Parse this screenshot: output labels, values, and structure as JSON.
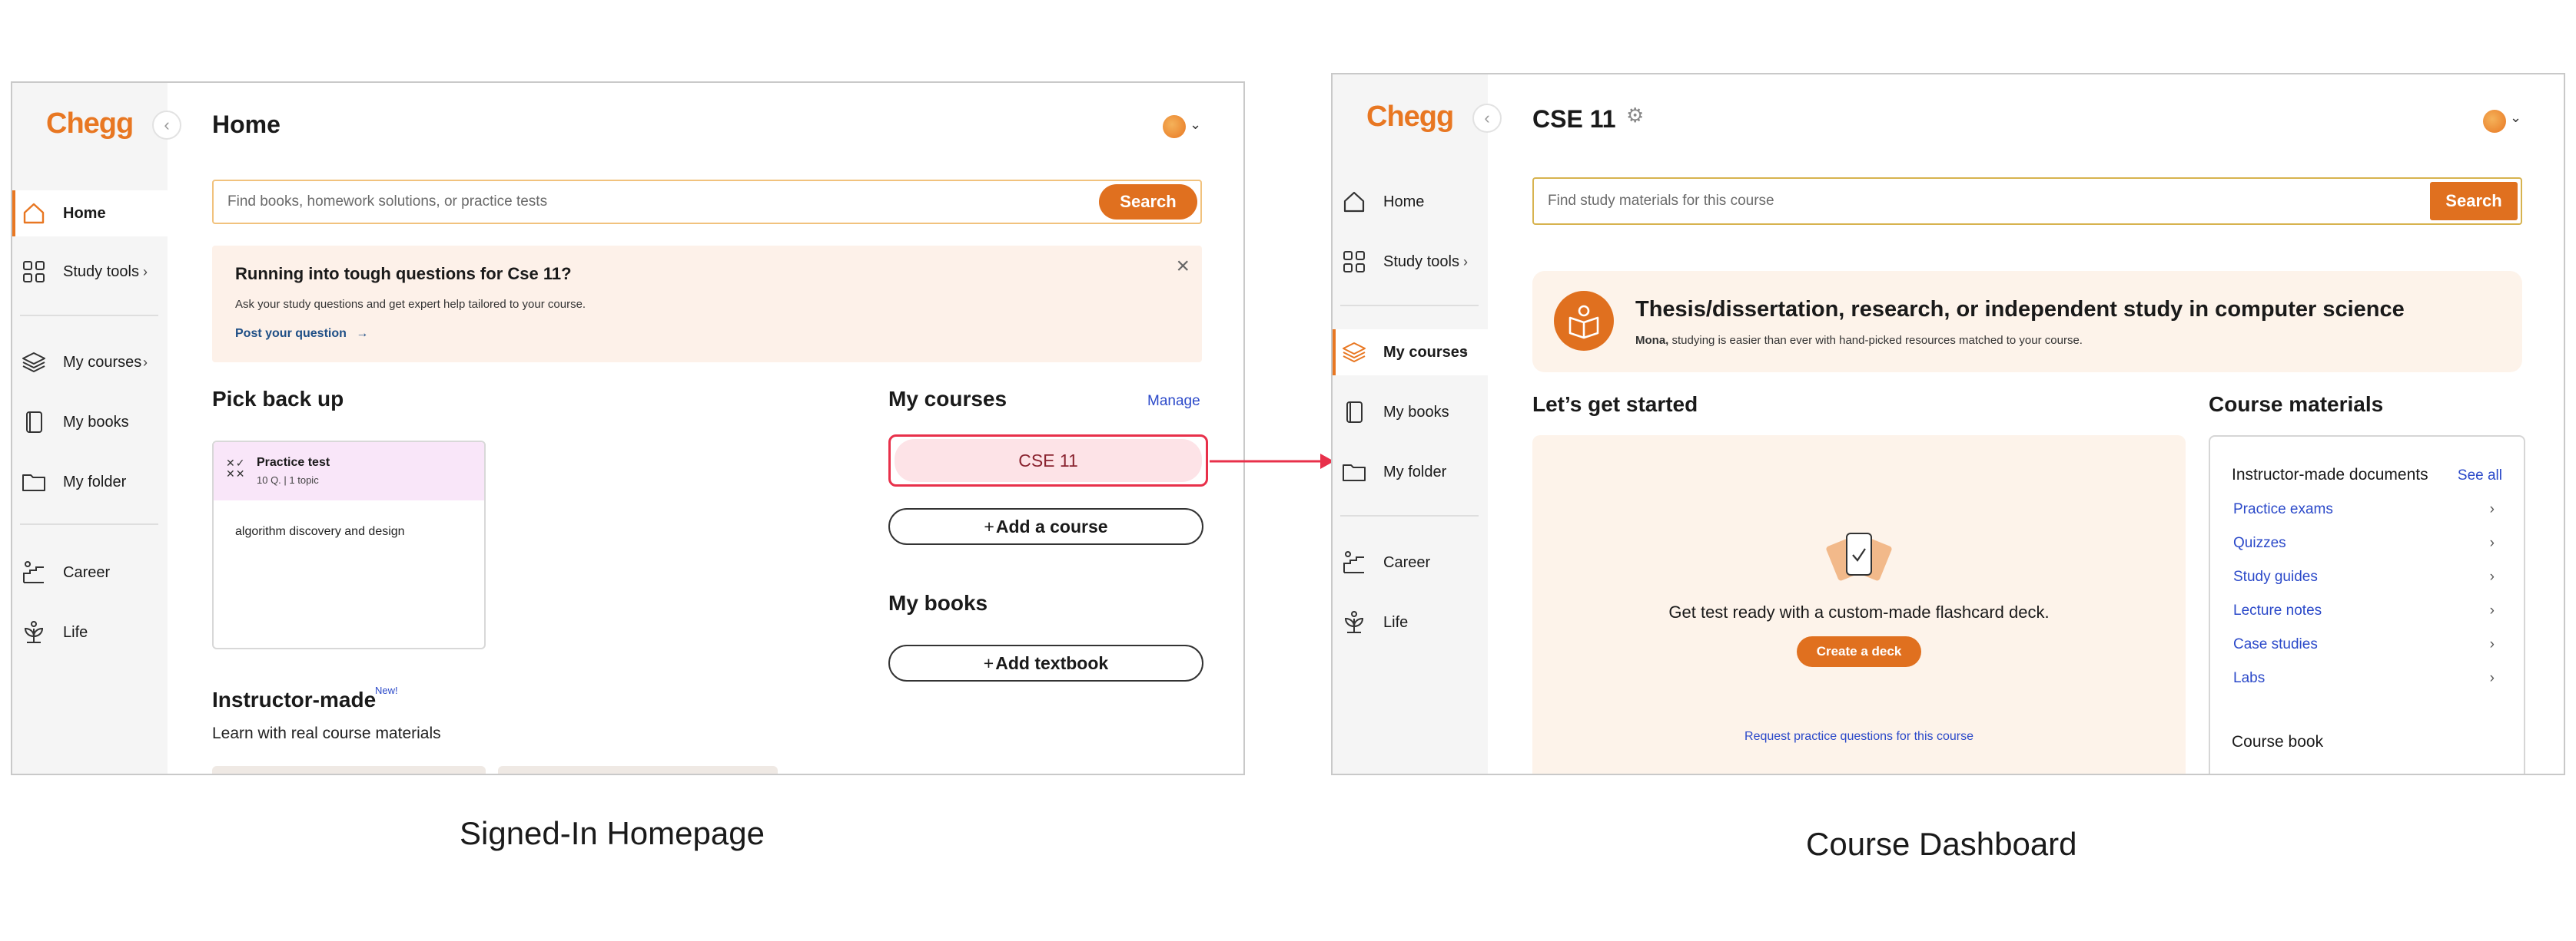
{
  "brand": {
    "logo": "Chegg",
    "accent": "#e87722",
    "button": "#e0701f",
    "link": "#2b49c9"
  },
  "home": {
    "title": "Home",
    "nav": [
      {
        "label": "Home",
        "icon": "home-icon"
      },
      {
        "label": "Study tools",
        "icon": "grid-icon"
      },
      {
        "label": "My courses",
        "icon": "layers-icon"
      },
      {
        "label": "My books",
        "icon": "book-icon"
      },
      {
        "label": "My folder",
        "icon": "folder-icon"
      },
      {
        "label": "Career",
        "icon": "career-icon"
      },
      {
        "label": "Life",
        "icon": "lotus-icon"
      }
    ],
    "search": {
      "placeholder": "Find books, homework solutions, or practice tests",
      "button": "Search"
    },
    "banner": {
      "title": "Running into tough questions for Cse 11?",
      "body": "Ask your study questions and get expert help tailored to your course.",
      "link": "Post your question",
      "link_arrow": "→"
    },
    "pick_back_up": {
      "title": "Pick back up",
      "card": {
        "title": "Practice test",
        "meta": "10 Q. | 1 topic",
        "topic": "algorithm discovery and design"
      }
    },
    "my_courses": {
      "title": "My courses",
      "manage": "Manage",
      "course": "CSE 11",
      "add_course": "Add a course"
    },
    "my_books": {
      "title": "My books",
      "add_textbook": "Add textbook"
    },
    "instructor_made": {
      "title": "Instructor-made",
      "badge": "New!",
      "subtitle": "Learn with real course materials"
    }
  },
  "course": {
    "title": "CSE 11",
    "nav": [
      {
        "label": "Home",
        "icon": "home-icon"
      },
      {
        "label": "Study tools",
        "icon": "grid-icon"
      },
      {
        "label": "My courses",
        "icon": "layers-icon"
      },
      {
        "label": "My books",
        "icon": "book-icon"
      },
      {
        "label": "My folder",
        "icon": "folder-icon"
      },
      {
        "label": "Career",
        "icon": "career-icon"
      },
      {
        "label": "Life",
        "icon": "lotus-icon"
      }
    ],
    "search": {
      "placeholder": "Find study materials for this course",
      "button": "Search"
    },
    "banner": {
      "title": "Thesis/dissertation, research, or independent study in computer science",
      "name": "Mona,",
      "body": " studying is easier than ever with hand-picked resources matched to your course."
    },
    "get_started": {
      "title": "Let’s get started",
      "text": "Get test ready with a custom-made flashcard deck.",
      "button": "Create a deck",
      "request_link": "Request practice questions for this course"
    },
    "materials": {
      "title": "Course materials",
      "section": "Instructor-made documents",
      "see_all": "See all",
      "links": [
        "Practice exams",
        "Quizzes",
        "Study guides",
        "Lecture notes",
        "Case studies",
        "Labs"
      ],
      "course_book": "Course book"
    }
  },
  "captions": {
    "left": "Signed-In Homepage",
    "right": "Course Dashboard"
  },
  "highlight_color": "#e8304a"
}
